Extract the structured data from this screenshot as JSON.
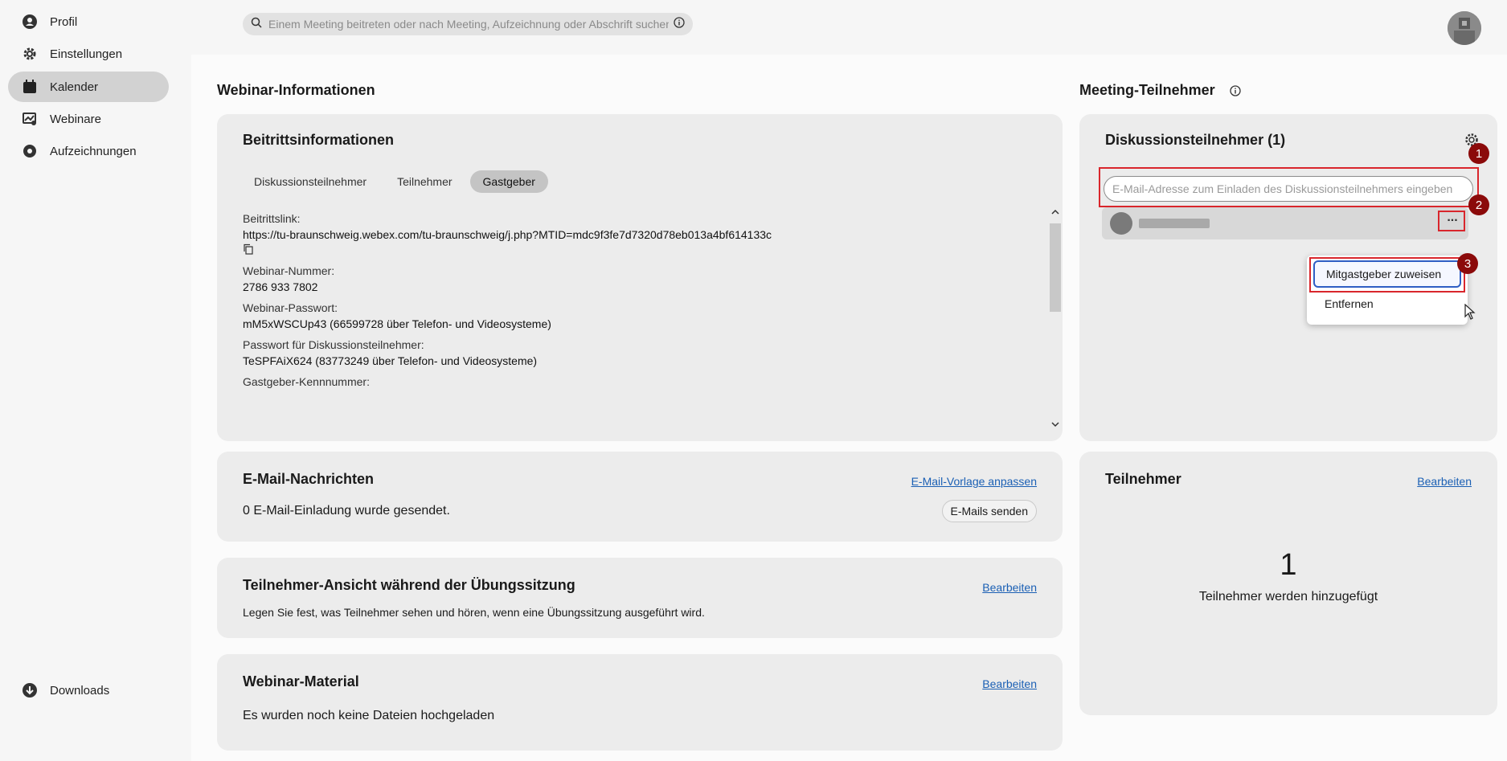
{
  "sidebar": {
    "items": [
      {
        "label": "Profil",
        "icon": "profile-icon"
      },
      {
        "label": "Einstellungen",
        "icon": "gear-icon"
      },
      {
        "label": "Kalender",
        "icon": "calendar-icon",
        "active": true
      },
      {
        "label": "Webinare",
        "icon": "webinar-icon"
      },
      {
        "label": "Aufzeichnungen",
        "icon": "recording-icon"
      }
    ],
    "downloads_label": "Downloads"
  },
  "search": {
    "placeholder": "Einem Meeting beitreten oder nach Meeting, Aufzeichnung oder Abschrift suchen"
  },
  "webinar_info": {
    "section_title": "Webinar-Informationen",
    "card_title": "Beitrittsinformationen",
    "tabs": [
      "Diskussionsteilnehmer",
      "Teilnehmer",
      "Gastgeber"
    ],
    "active_tab": "Gastgeber",
    "fields": [
      {
        "label": "Beitrittslink:",
        "value": "https://tu-braunschweig.webex.com/tu-braunschweig/j.php?MTID=mdc9f3fe7d7320d78eb013a4bf614133c"
      },
      {
        "label": "Webinar-Nummer:",
        "value": "2786 933 7802"
      },
      {
        "label": "Webinar-Passwort:",
        "value": "mM5xWSCUp43 (66599728 über Telefon- und Videosysteme)"
      },
      {
        "label": "Passwort für Diskussionsteilnehmer:",
        "value": "TeSPFAiX624 (83773249 über Telefon- und Videosysteme)"
      },
      {
        "label": "Gastgeber-Kennnummer:",
        "value": ""
      }
    ]
  },
  "email_card": {
    "title": "E-Mail-Nachrichten",
    "link": "E-Mail-Vorlage anpassen",
    "status": "0 E-Mail-Einladung wurde gesendet.",
    "button": "E-Mails senden"
  },
  "practice_card": {
    "title": "Teilnehmer-Ansicht während der Übungssitzung",
    "link": "Bearbeiten",
    "desc": "Legen Sie fest, was Teilnehmer sehen und hören, wenn eine Übungssitzung ausgeführt wird."
  },
  "material_card": {
    "title": "Webinar-Material",
    "link": "Bearbeiten",
    "desc": "Es wurden noch keine Dateien hochgeladen"
  },
  "meeting_participants": {
    "section_title": "Meeting-Teilnehmer",
    "panelists_title": "Diskussionsteilnehmer (1)",
    "email_placeholder": "E-Mail-Adresse zum Einladen des Diskussionsteilnehmers eingeben",
    "more_label": "...",
    "menu": [
      "Mitgastgeber zuweisen",
      "Entfernen"
    ],
    "badges": [
      "1",
      "2",
      "3"
    ]
  },
  "attendees_card": {
    "title": "Teilnehmer",
    "link": "Bearbeiten",
    "count": "1",
    "desc": "Teilnehmer werden hinzugefügt"
  }
}
